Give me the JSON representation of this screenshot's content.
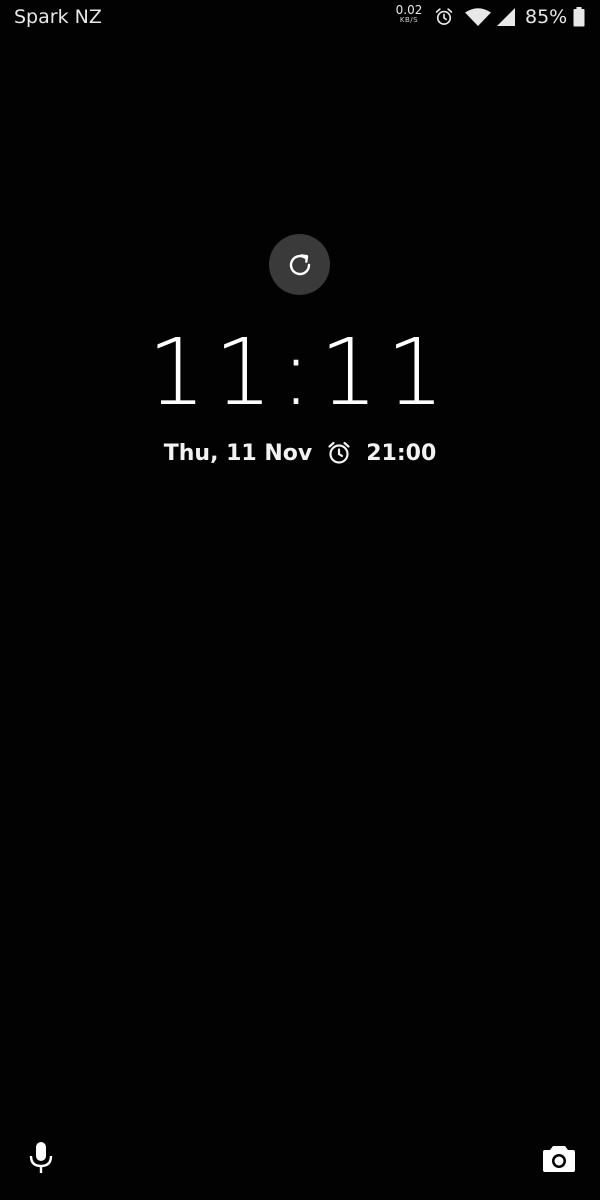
{
  "status_bar": {
    "carrier": "Spark NZ",
    "net_speed_value": "0.02",
    "net_speed_unit": "KB/S",
    "battery_percent": "85%",
    "icons": [
      "alarm-icon",
      "wifi-icon",
      "cell-signal-icon",
      "battery-icon"
    ]
  },
  "lock_screen": {
    "refresh_icon": "refresh-icon",
    "time": "11:11",
    "date": "Thu, 11 Nov",
    "alarm_time": "21:00"
  },
  "shortcuts": {
    "left": "microphone-icon",
    "right": "camera-icon"
  },
  "colors": {
    "background": "#020202",
    "text": "#ffffff",
    "refresh_button_bg": "#3a3a3a"
  }
}
